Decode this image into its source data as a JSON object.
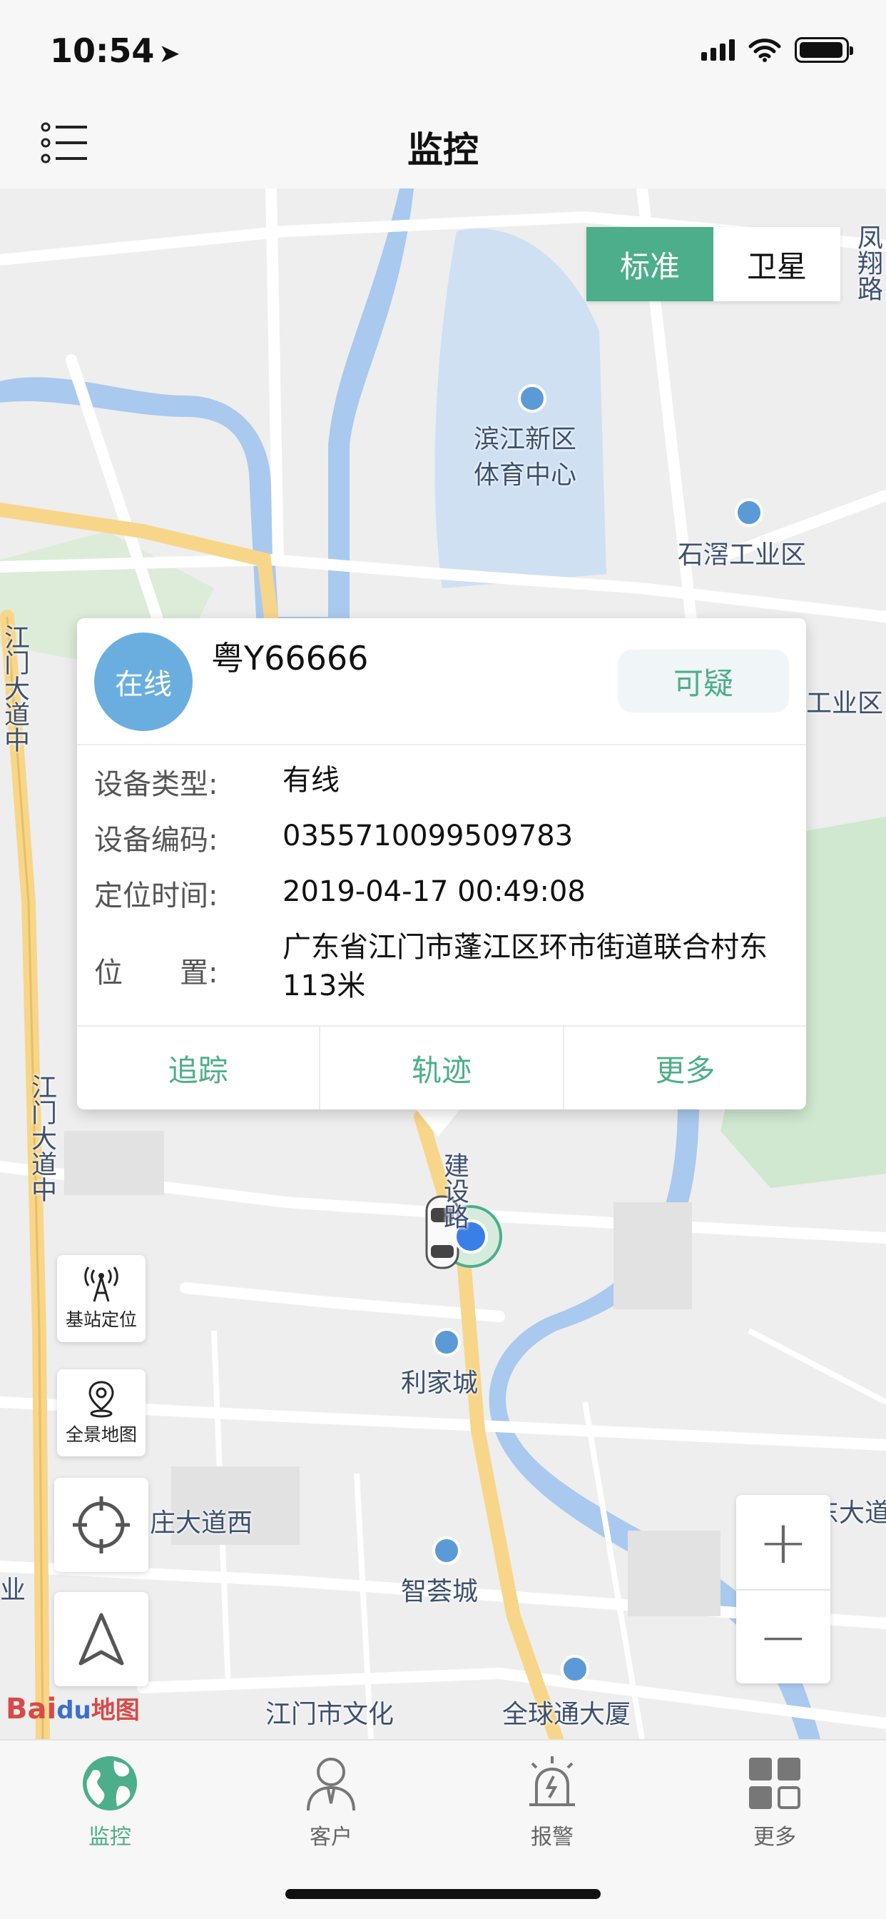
{
  "status_bar": {
    "time": "10:54",
    "location_arrow_icon": "location-arrow-icon"
  },
  "nav": {
    "title": "监控",
    "menu_icon": "list-menu-icon"
  },
  "map": {
    "type_toggle": {
      "standard": "标准",
      "satellite": "卫星",
      "selected": "标准"
    },
    "labels": {
      "binjiang_1": "滨江新区",
      "binjiang_2": "体育中心",
      "shiti": "石滘工业区",
      "gongye": "工业区",
      "fengxiang": "凤翔路",
      "jiangmen_road_1": "江门大道中",
      "jiangmen_road_2": "江门大道中",
      "jianshe": "建设路",
      "lijiacheng": "利家城",
      "zhuang": "庄大道西",
      "zhihui": "智荟城",
      "wenhua": "江门市文化",
      "quanqiutong": "全球通大厦",
      "ye": "业",
      "dadao": "东大道"
    },
    "baidu_logo": {
      "bai": "Bai",
      "du": "du",
      "text": "地图"
    },
    "accent_color": "#4cae8a"
  },
  "vehicle_card": {
    "status_badge": "在线",
    "plate": "粤Y66666",
    "suspicious_button": "可疑",
    "device_type_label": "设备类型:",
    "device_type": "有线",
    "device_code_label": "设备编码:",
    "device_code": "0355710099509783",
    "locate_time_label": "定位时间:",
    "locate_time": "2019-04-17 00:49:08",
    "location_label": "位　　置:",
    "location": "广东省江门市蓬江区环市街道联合村东113米",
    "actions": {
      "track": "追踪",
      "trajectory": "轨迹",
      "more": "更多"
    }
  },
  "map_controls": {
    "base_station": "基站定位",
    "panorama": "全景地图",
    "zoom_in": "+",
    "zoom_out": "−"
  },
  "tabbar": {
    "items": [
      {
        "label": "监控",
        "icon": "globe-icon",
        "active": true
      },
      {
        "label": "客户",
        "icon": "user-icon",
        "active": false
      },
      {
        "label": "报警",
        "icon": "alarm-icon",
        "active": false
      },
      {
        "label": "更多",
        "icon": "grid-icon",
        "active": false
      }
    ]
  }
}
